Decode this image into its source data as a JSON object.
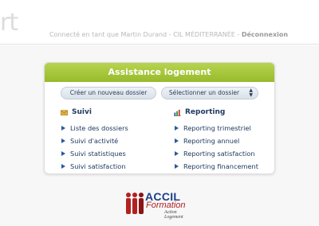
{
  "header": {
    "logo_fragment": "rt",
    "user_prefix": "Connecté en tant que",
    "user_name": "Martin Durand",
    "separator1": "-",
    "organization": "CIL MÉDITERRANÉE",
    "separator2": "-",
    "logout_label": "Déconnexion"
  },
  "panel": {
    "title": "Assistance logement",
    "buttons": {
      "new_folder": "Créer un nouveau dossier",
      "select_folder": "Sélectionner un dossier"
    },
    "suivi": {
      "title": "Suivi",
      "items": [
        "Liste des dossiers",
        "Suivi d'activité",
        "Suivi statistiques",
        "Suivi satisfaction"
      ]
    },
    "reporting": {
      "title": "Reporting",
      "items": [
        "Reporting trimestriel",
        "Reporting annuel",
        "Reporting satisfaction",
        "Reporting financement"
      ]
    }
  },
  "partner_logo": {
    "brand": "ACCIL",
    "sub": "Formation",
    "tagline_line1": "Action",
    "tagline_line2": "Logement"
  },
  "colors": {
    "panel_header": "#a5c63a",
    "link_text": "#1f3a60",
    "brand_blue": "#1b3f86",
    "brand_red": "#b02222"
  },
  "icons": {
    "suivi": "envelope-icon",
    "reporting": "bar-chart-icon",
    "bullets": "triangle-right-icon",
    "select": "updown-arrows-icon"
  }
}
